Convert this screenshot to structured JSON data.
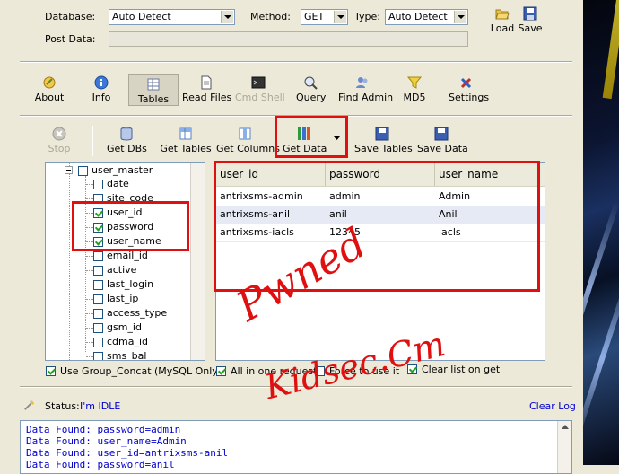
{
  "form": {
    "database_label": "Database:",
    "database_value": "Auto Detect",
    "method_label": "Method:",
    "method_value": "GET",
    "type_label": "Type:",
    "type_value": "Auto Detect",
    "post_data_label": "Post Data:",
    "post_data_value": "",
    "load_label": "Load",
    "save_label": "Save"
  },
  "main_toolbar": {
    "about": "About",
    "info": "Info",
    "tables": "Tables",
    "read_files": "Read Files",
    "cmd_shell": "Cmd Shell",
    "query": "Query",
    "find_admin": "Find Admin",
    "md5": "MD5",
    "settings": "Settings"
  },
  "tables_toolbar": {
    "stop": "Stop",
    "get_dbs": "Get DBs",
    "get_tables": "Get Tables",
    "get_columns": "Get Columns",
    "get_data": "Get Data",
    "save_tables": "Save Tables",
    "save_data": "Save Data"
  },
  "tree": {
    "table": "user_master",
    "columns": [
      {
        "name": "date",
        "checked": false
      },
      {
        "name": "site_code",
        "checked": false
      },
      {
        "name": "user_id",
        "checked": true
      },
      {
        "name": "password",
        "checked": true
      },
      {
        "name": "user_name",
        "checked": true
      },
      {
        "name": "email_id",
        "checked": false
      },
      {
        "name": "active",
        "checked": false
      },
      {
        "name": "last_login",
        "checked": false
      },
      {
        "name": "last_ip",
        "checked": false
      },
      {
        "name": "access_type",
        "checked": false
      },
      {
        "name": "gsm_id",
        "checked": false
      },
      {
        "name": "cdma_id",
        "checked": false
      },
      {
        "name": "sms_bal",
        "checked": false
      }
    ]
  },
  "grid": {
    "headers": [
      "user_id",
      "password",
      "user_name"
    ],
    "rows": [
      [
        "antrixsms-admin",
        "admin",
        "Admin"
      ],
      [
        "antrixsms-anil",
        "anil",
        "Anil"
      ],
      [
        "antrixsms-iacls",
        "12345",
        "iacls"
      ]
    ]
  },
  "options": {
    "group_concat": "Use Group_Concat (MySQL Only)",
    "all_in_one": "All in one request.",
    "force": "Force to use it",
    "clear_list": "Clear list on get"
  },
  "status": {
    "label": "Status:",
    "value": "I'm IDLE",
    "clear_log": "Clear Log"
  },
  "log": [
    "Data Found: password=admin",
    "Data Found: user_name=Admin",
    "Data Found: user_id=antrixsms-anil",
    "Data Found: password=anil"
  ],
  "overlay": {
    "pwned": "Pwned",
    "signature": "Kidsec.Cm"
  },
  "colors": {
    "window_bg": "#ece9d8",
    "highlight_red": "#e01010",
    "log_text": "#0000cc",
    "status_text": "#0000cc"
  }
}
